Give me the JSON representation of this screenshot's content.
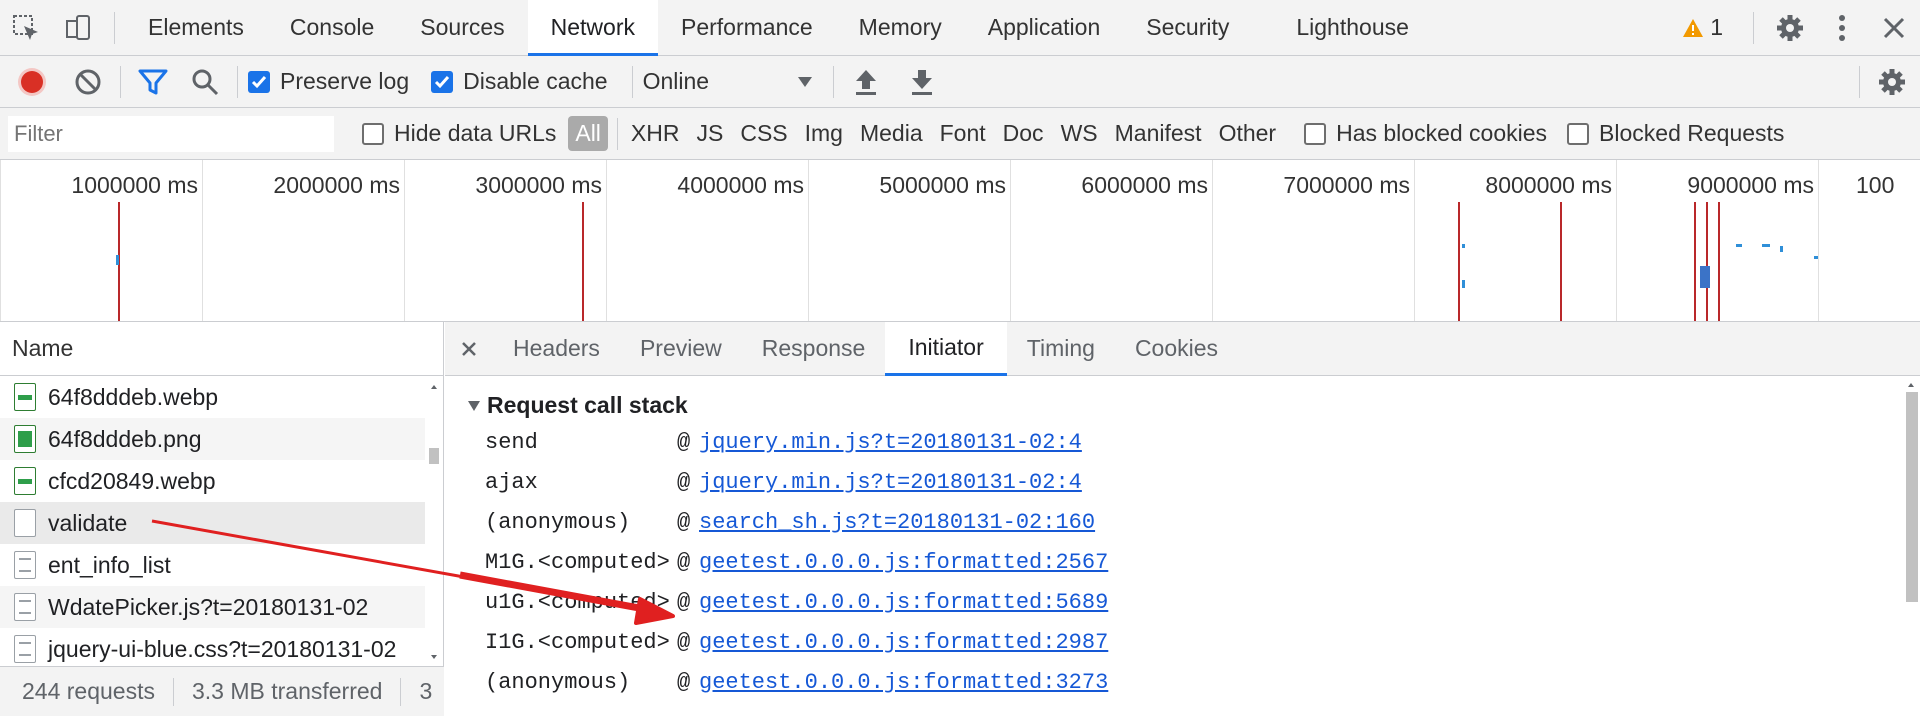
{
  "tabs": [
    "Elements",
    "Console",
    "Sources",
    "Network",
    "Performance",
    "Memory",
    "Application",
    "Security",
    "Lighthouse"
  ],
  "active_tab": "Network",
  "warnings_count": "1",
  "toolbar": {
    "preserve_log_label": "Preserve log",
    "disable_cache_label": "Disable cache",
    "throttle_value": "Online"
  },
  "filter": {
    "placeholder": "Filter",
    "hide_data_urls_label": "Hide data URLs",
    "types": [
      "All",
      "XHR",
      "JS",
      "CSS",
      "Img",
      "Media",
      "Font",
      "Doc",
      "WS",
      "Manifest",
      "Other"
    ],
    "selected_type": "All",
    "has_blocked_cookies_label": "Has blocked cookies",
    "blocked_requests_label": "Blocked Requests"
  },
  "overview": {
    "ticks": [
      "1000000 ms",
      "2000000 ms",
      "3000000 ms",
      "4000000 ms",
      "5000000 ms",
      "6000000 ms",
      "7000000 ms",
      "8000000 ms",
      "9000000 ms",
      "100"
    ]
  },
  "requests": {
    "column_header": "Name",
    "items": [
      {
        "name": "64f8dddeb.webp",
        "icon": "image-icon"
      },
      {
        "name": "64f8dddeb.png",
        "icon": "image-icon"
      },
      {
        "name": "cfcd20849.webp",
        "icon": "image-icon"
      },
      {
        "name": "validate",
        "icon": "blank-file-icon"
      },
      {
        "name": "ent_info_list",
        "icon": "document-icon"
      },
      {
        "name": "WdatePicker.js?t=20180131-02",
        "icon": "document-icon"
      },
      {
        "name": "jquery-ui-blue.css?t=20180131-02",
        "icon": "document-icon"
      }
    ],
    "status_requests": "244 requests",
    "status_transferred": "3.3 MB transferred",
    "status_more": "3"
  },
  "detail": {
    "tabs": [
      "Headers",
      "Preview",
      "Response",
      "Initiator",
      "Timing",
      "Cookies"
    ],
    "active_tab": "Initiator",
    "section_title": "Request call stack",
    "stack": [
      {
        "fn": "send",
        "loc": "jquery.min.js?t=20180131-02:4"
      },
      {
        "fn": "ajax",
        "loc": "jquery.min.js?t=20180131-02:4"
      },
      {
        "fn": "(anonymous)",
        "loc": "search_sh.js?t=20180131-02:160"
      },
      {
        "fn": "M1G.<computed>",
        "loc": "geetest.0.0.0.js:formatted:2567"
      },
      {
        "fn": "u1G.<computed>",
        "loc": "geetest.0.0.0.js:formatted:5689"
      },
      {
        "fn": "I1G.<computed>",
        "loc": "geetest.0.0.0.js:formatted:2987"
      },
      {
        "fn": "(anonymous)",
        "loc": "geetest.0.0.0.js:formatted:3273"
      }
    ]
  },
  "colors": {
    "accent": "#1a73e8",
    "record": "#d93025",
    "arrow": "#e02020",
    "waterfall_line": "#b9282a"
  }
}
